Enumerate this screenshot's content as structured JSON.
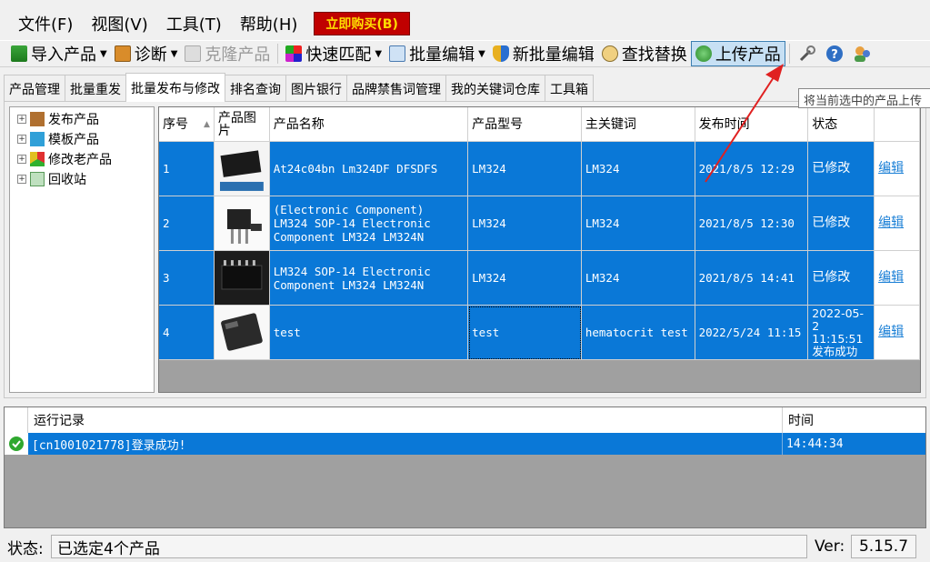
{
  "menu": {
    "items": [
      "文件(F)",
      "视图(V)",
      "工具(T)",
      "帮助(H)"
    ],
    "buy_label": "立即购买(B)"
  },
  "toolbar": {
    "import_label": "导入产品",
    "diagnose_label": "诊断",
    "clone_label": "克隆产品",
    "quickmatch_label": "快速匹配",
    "bulkedit_label": "批量编辑",
    "newbulkedit_label": "新批量编辑",
    "findreplace_label": "查找替换",
    "upload_label": "上传产品"
  },
  "tabs": [
    "产品管理",
    "批量重发",
    "批量发布与修改",
    "排名查询",
    "图片银行",
    "品牌禁售词管理",
    "我的关键词仓库",
    "工具箱"
  ],
  "tooltip": "将当前选中的产品上传",
  "tree": [
    "发布产品",
    "模板产品",
    "修改老产品",
    "回收站"
  ],
  "grid": {
    "headers": [
      "序号",
      "产品图片",
      "产品名称",
      "产品型号",
      "主关键词",
      "发布时间",
      "状态",
      ""
    ],
    "rows": [
      {
        "num": "1",
        "name": "At24c04bn Lm324DF DFSDFS",
        "model": "LM324",
        "keyword": "LM324",
        "time": "2021/8/5 12:29",
        "status": "已修改",
        "edit": "编辑"
      },
      {
        "num": "2",
        "name": "(Electronic Component) LM324 SOP-14 Electronic Component LM324 LM324N",
        "model": "LM324",
        "keyword": "LM324",
        "time": "2021/8/5 12:30",
        "status": "已修改",
        "edit": "编辑"
      },
      {
        "num": "3",
        "name": "LM324 SOP-14 Electronic Component LM324 LM324N",
        "model": "LM324",
        "keyword": "LM324",
        "time": "2021/8/5 14:41",
        "status": "已修改",
        "edit": "编辑"
      },
      {
        "num": "4",
        "name": "test",
        "model": "test",
        "keyword": "hematocrit test",
        "time": "2022/5/24 11:15",
        "status": "2022-05-2 11:15:51 发布成功",
        "edit": "编辑"
      }
    ]
  },
  "log": {
    "headers": [
      "运行记录",
      "时间"
    ],
    "rows": [
      {
        "text": "[cn1001021778]登录成功!",
        "time": "14:44:34"
      }
    ]
  },
  "status": {
    "label": "状态:",
    "value": "已选定4个产品",
    "ver_label": "Ver:",
    "ver_value": "5.15.7"
  },
  "colors": {
    "selection": "#0a78d7",
    "buy_bg": "#c00000",
    "arrow": "#e02020"
  }
}
